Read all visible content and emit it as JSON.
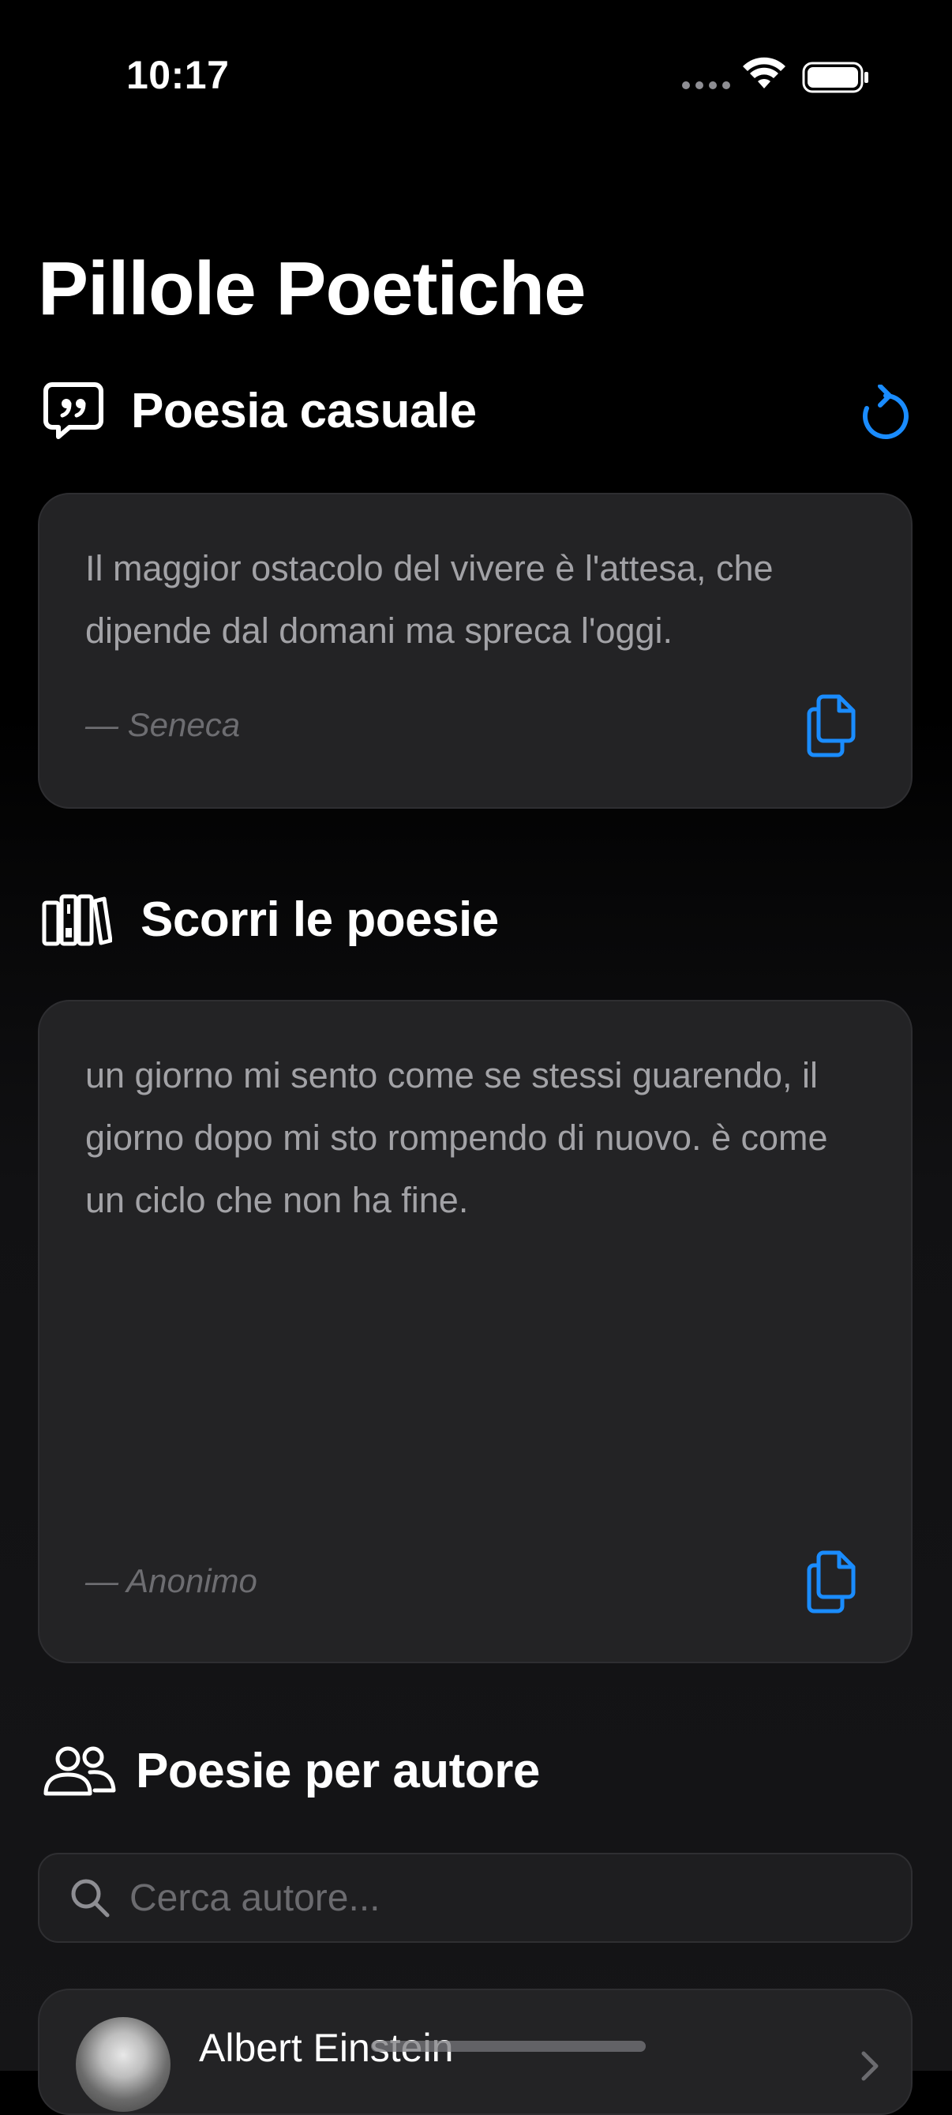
{
  "status_bar": {
    "time": "10:17"
  },
  "app": {
    "title": "Pillole Poetiche"
  },
  "random_section": {
    "title": "Poesia casuale",
    "icon": "quote-bubble-icon",
    "refresh_icon": "refresh-icon",
    "poem": {
      "text": "Il maggior ostacolo del vivere è l'attesa, che dipende dal domani ma spreca l'oggi.",
      "author": "— Seneca"
    }
  },
  "browse_section": {
    "title": "Scorri le poesie",
    "icon": "books-icon",
    "poem": {
      "text": "un giorno mi sento come se stessi guarendo, il giorno dopo mi sto rompendo di nuovo. è come un ciclo che non ha fine.",
      "author": "— Anonimo"
    }
  },
  "authors_section": {
    "title": "Poesie per autore",
    "icon": "people-icon",
    "search": {
      "placeholder": "Cerca autore...",
      "value": ""
    },
    "authors": [
      {
        "name": "Albert Einstein"
      }
    ]
  },
  "colors": {
    "accent": "#1a8cff",
    "background": "#000000",
    "card": "#232325"
  }
}
